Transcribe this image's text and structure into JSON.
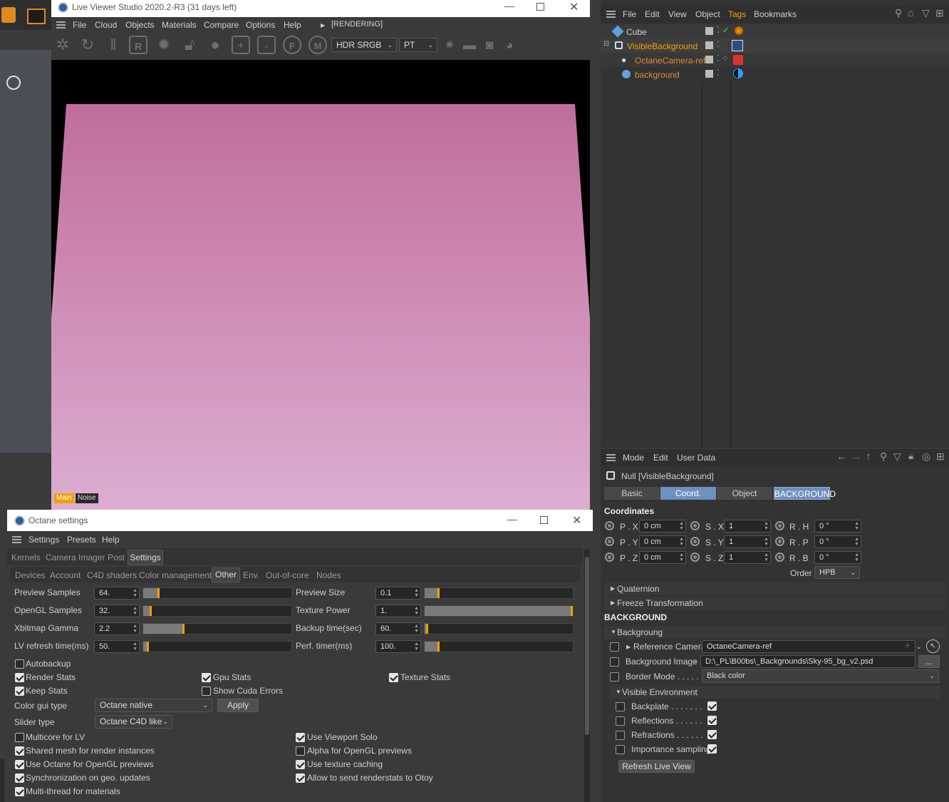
{
  "live_viewer": {
    "title": "Live Viewer Studio 2020.2-R3 (31 days left)",
    "menu": [
      "File",
      "Cloud",
      "Objects",
      "Materials",
      "Compare",
      "Options",
      "Help"
    ],
    "status": "[RENDERING]",
    "tonemap": "HDR SRGB",
    "kernel": "PT",
    "toolbar_letters": [
      "R",
      "F",
      "M"
    ],
    "channel_tabs": [
      "Main",
      "Noise"
    ]
  },
  "object_manager": {
    "menu": [
      "File",
      "Edit",
      "View",
      "Object",
      "Tags",
      "Bookmarks"
    ],
    "objects": [
      {
        "name": "Cube",
        "color": "#cfcfcf"
      },
      {
        "name": "VisibleBackground",
        "color": "#f0a000"
      },
      {
        "name": "OctaneCamera-ref",
        "color": "#e08a30"
      },
      {
        "name": "background",
        "color": "#e08a30"
      }
    ]
  },
  "attributes": {
    "menu": [
      "Mode",
      "Edit",
      "User Data"
    ],
    "object_title": "Null [VisibleBackground]",
    "tabs": [
      "Basic",
      "Coord.",
      "Object",
      "BACKGROUND"
    ],
    "section_coordinates": "Coordinates",
    "coords": [
      {
        "p_label": "P . X",
        "p_val": "0 cm",
        "s_label": "S . X",
        "s_val": "1",
        "r_label": "R . H",
        "r_val": "0 °"
      },
      {
        "p_label": "P . Y",
        "p_val": "0 cm",
        "s_label": "S . Y",
        "s_val": "1",
        "r_label": "R . P",
        "r_val": "0 °"
      },
      {
        "p_label": "P . Z",
        "p_val": "0 cm",
        "s_label": "S . Z",
        "s_val": "1",
        "r_label": "R . B",
        "r_val": "0 °"
      }
    ],
    "order_label": "Order",
    "order_value": "HPB",
    "quaternion": "Quaternion",
    "freeze": "Freeze Transformation",
    "section_background": "BACKGROUND",
    "group_background": "Backgroung",
    "ref_camera_label": "Reference Camera",
    "ref_camera_value": "OctaneCamera-ref",
    "bg_image_label": "Background Image",
    "bg_image_value": "D:\\_PL\\B00bs\\_Backgrounds\\Sky-95_bg_v2.psd",
    "browse": "...",
    "border_mode_label": "Border Mode . . . . .",
    "border_mode_value": "Black color",
    "visible_env": "Visible Environment",
    "env_items": [
      {
        "label": "Backplate . . . . . . .",
        "checked": true
      },
      {
        "label": "Reflections . . . . . .",
        "checked": true
      },
      {
        "label": "Refractions . . . . . .",
        "checked": true
      },
      {
        "label": "Importance sampling",
        "checked": true
      }
    ],
    "refresh_button": "Refresh Live View"
  },
  "octane_settings": {
    "title": "Octane settings",
    "menu": [
      "Settings",
      "Presets",
      "Help"
    ],
    "tabs": [
      "Kernels",
      "Camera Imager",
      "Post",
      "Settings"
    ],
    "subtabs": [
      "Devices",
      "Account",
      "C4D shaders",
      "Color management",
      "Other",
      "Env.",
      "Out-of-core",
      "Nodes"
    ],
    "left_params": [
      {
        "label": "Preview Samples",
        "value": "64.",
        "level": 0.1
      },
      {
        "label": "OpenGL Samples",
        "value": "32.",
        "level": 0.05
      },
      {
        "label": "Xbitmap Gamma",
        "value": "2.2",
        "level": 0.27
      },
      {
        "label": "LV refresh time(ms)",
        "value": "50.",
        "level": 0.03
      }
    ],
    "right_params": [
      {
        "label": "Preview Size",
        "value": "0.1",
        "level": 0.09
      },
      {
        "label": "Texture Power",
        "value": "1.",
        "level": 1.0
      },
      {
        "label": "Backup time(sec)",
        "value": "60.",
        "level": 0.0
      },
      {
        "label": "Perf. timer(ms)",
        "value": "100.",
        "level": 0.09
      }
    ],
    "autobackup": "Autobackup",
    "render_stats": "Render Stats",
    "gpu_stats": "Gpu Stats",
    "texture_stats": "Texture Stats",
    "keep_stats": "Keep Stats",
    "show_cuda": "Show Cuda Errors",
    "color_gui_label": "Color gui type",
    "color_gui_value": "Octane native",
    "apply": "Apply",
    "slider_type_label": "Slider type",
    "slider_type_value": "Octane C4D like",
    "multicore": "Multicore for LV",
    "viewport_solo": "Use Viewport Solo",
    "shared_mesh": "Shared mesh for render instances",
    "alpha_opengl": "Alpha for OpenGL previews",
    "use_octane_opengl": "Use Octane for OpenGL previews",
    "texture_caching": "Use texture caching",
    "sync_geo": "Synchronization on geo. updates",
    "renderstats_otoy": "Allow to send renderstats to Otoy",
    "multithread": "Multi-thread for materials"
  },
  "colors": {
    "accent_orange": "#f0a000",
    "selected_tab": "#6f8fbf",
    "render_top": "#c06e9c",
    "render_bottom": "#ddaed1"
  }
}
